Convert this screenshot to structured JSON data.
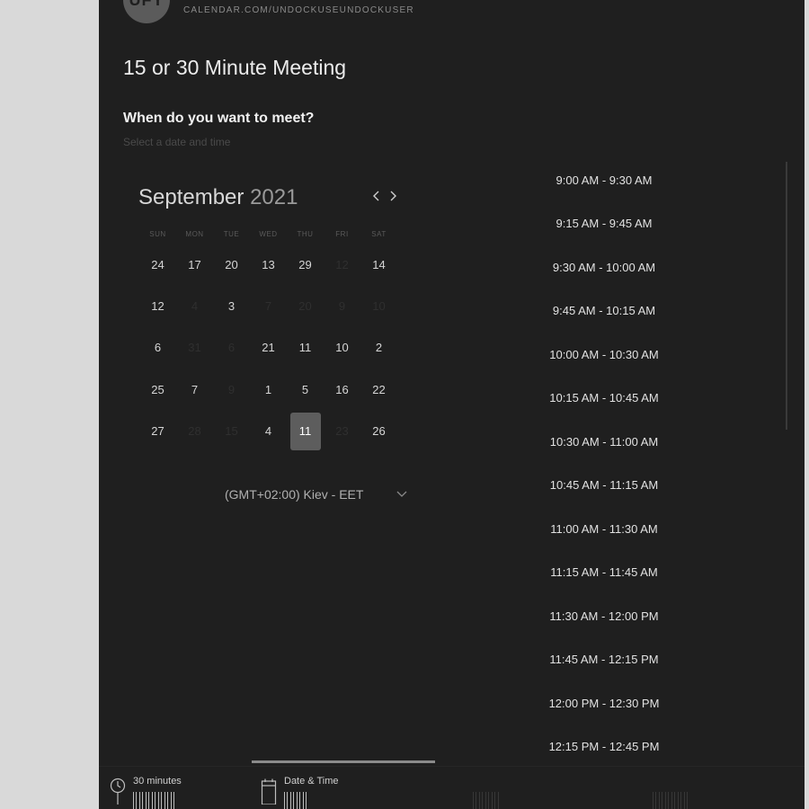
{
  "header": {
    "avatar_initials": "UFY",
    "url": "CALENDAR.COM/UNDOCKUSEUNDOCKUSER"
  },
  "meeting": {
    "title": "15 or 30 Minute Meeting",
    "question": "When do you want to meet?",
    "subtext": "Select a date and time"
  },
  "calendar": {
    "month": "September",
    "year": "2021",
    "weekdays": [
      "SUN",
      "MON",
      "TUE",
      "WED",
      "THU",
      "FRI",
      "SAT"
    ],
    "rows": [
      [
        "24",
        "17",
        "20",
        "13",
        "29",
        "12",
        "14"
      ],
      [
        "12",
        "4",
        "3",
        "7",
        "20",
        "9",
        "10"
      ],
      [
        "6",
        "31",
        "6",
        "21",
        "11",
        "10",
        "2"
      ],
      [
        "25",
        "7",
        "9",
        "1",
        "5",
        "16",
        "22"
      ],
      [
        "27",
        "28",
        "15",
        "4",
        "11",
        "23",
        "26"
      ]
    ],
    "selected_day": "11",
    "timezone": "(GMT+02:00) Kiev - EET"
  },
  "time_slots": [
    "9:00 AM - 9:30 AM",
    "9:15 AM - 9:45 AM",
    "9:30 AM - 10:00 AM",
    "9:45 AM - 10:15 AM",
    "10:00 AM - 10:30 AM",
    "10:15 AM - 10:45 AM",
    "10:30 AM - 11:00 AM",
    "10:45 AM - 11:15 AM",
    "11:00 AM - 11:30 AM",
    "11:15 AM - 11:45 AM",
    "11:30 AM - 12:00 PM",
    "11:45 AM - 12:15 PM",
    "12:00 PM - 12:30 PM",
    "12:15 PM - 12:45 PM"
  ],
  "steps": {
    "duration": "30 minutes",
    "date_time": "Date & Time"
  },
  "colors": {
    "panel_bg": "#1f1f1f",
    "page_bg": "#d9d9d9",
    "selected_bg": "#5d5d5d"
  }
}
